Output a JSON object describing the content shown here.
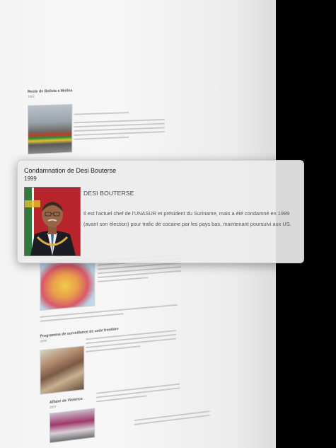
{
  "popup": {
    "title": "Condamnation de Desi Bouterse",
    "year": "1999",
    "name": "DESI BOUTERSE",
    "description": "Il est l'actuel chef de l'UNASUR et président du Suriname, mais a été condamné en 1999 (avant son élection) pour trafic de cocaine par les pays bas, maintenant poursuivi aux US."
  },
  "background": {
    "entry1_title": "Reste de Bolivia a Molina",
    "entry1_year": "1982",
    "entry3_title": "Programme de surveillance de cette frontière",
    "entry3_year": "2008",
    "entry4_title": "Affaire de Violence",
    "entry4_year": "2007"
  }
}
